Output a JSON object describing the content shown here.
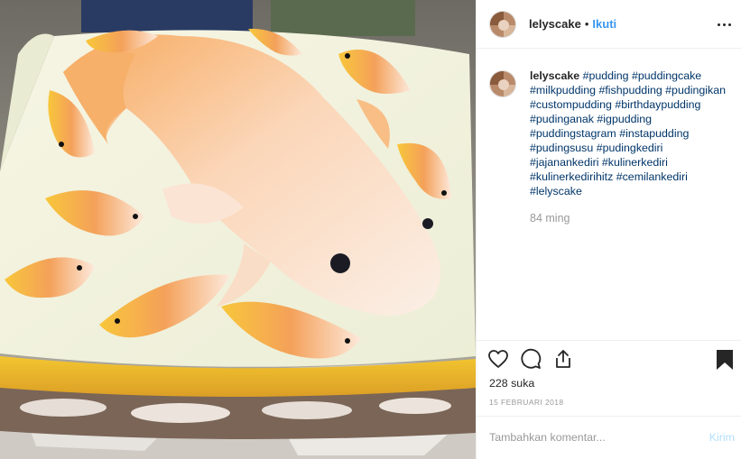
{
  "post": {
    "photo_alt": "",
    "username": "lelyscake",
    "separator": "•",
    "follow_label": "Ikuti",
    "caption_username": "lelyscake",
    "caption_text": "#pudding #puddingcake #milkpudding #fishpudding #pudingikan #custompudding #birthdaypudding #pudinganak #igpudding #puddingstagram #instapudding #pudingsusu #pudingkediri #jajanankediri #kulinerkediri #kulinerkedirihitz #cemilankediri #lelyscake",
    "time_ago": "84 ming",
    "likes": "228 suka",
    "date": "15 FEBRUARI 2018"
  },
  "icons": {
    "like": "heart-icon",
    "comment": "comment-icon",
    "share": "share-icon",
    "save": "bookmark-icon",
    "more": "more-icon"
  },
  "comment": {
    "placeholder": "Tambahkan komentar...",
    "post_label": "Kirim"
  },
  "colors": {
    "link": "#3897f0",
    "hashtag": "#003569",
    "muted": "#999999",
    "post_disabled": "#b2dffc",
    "text": "#262626"
  }
}
